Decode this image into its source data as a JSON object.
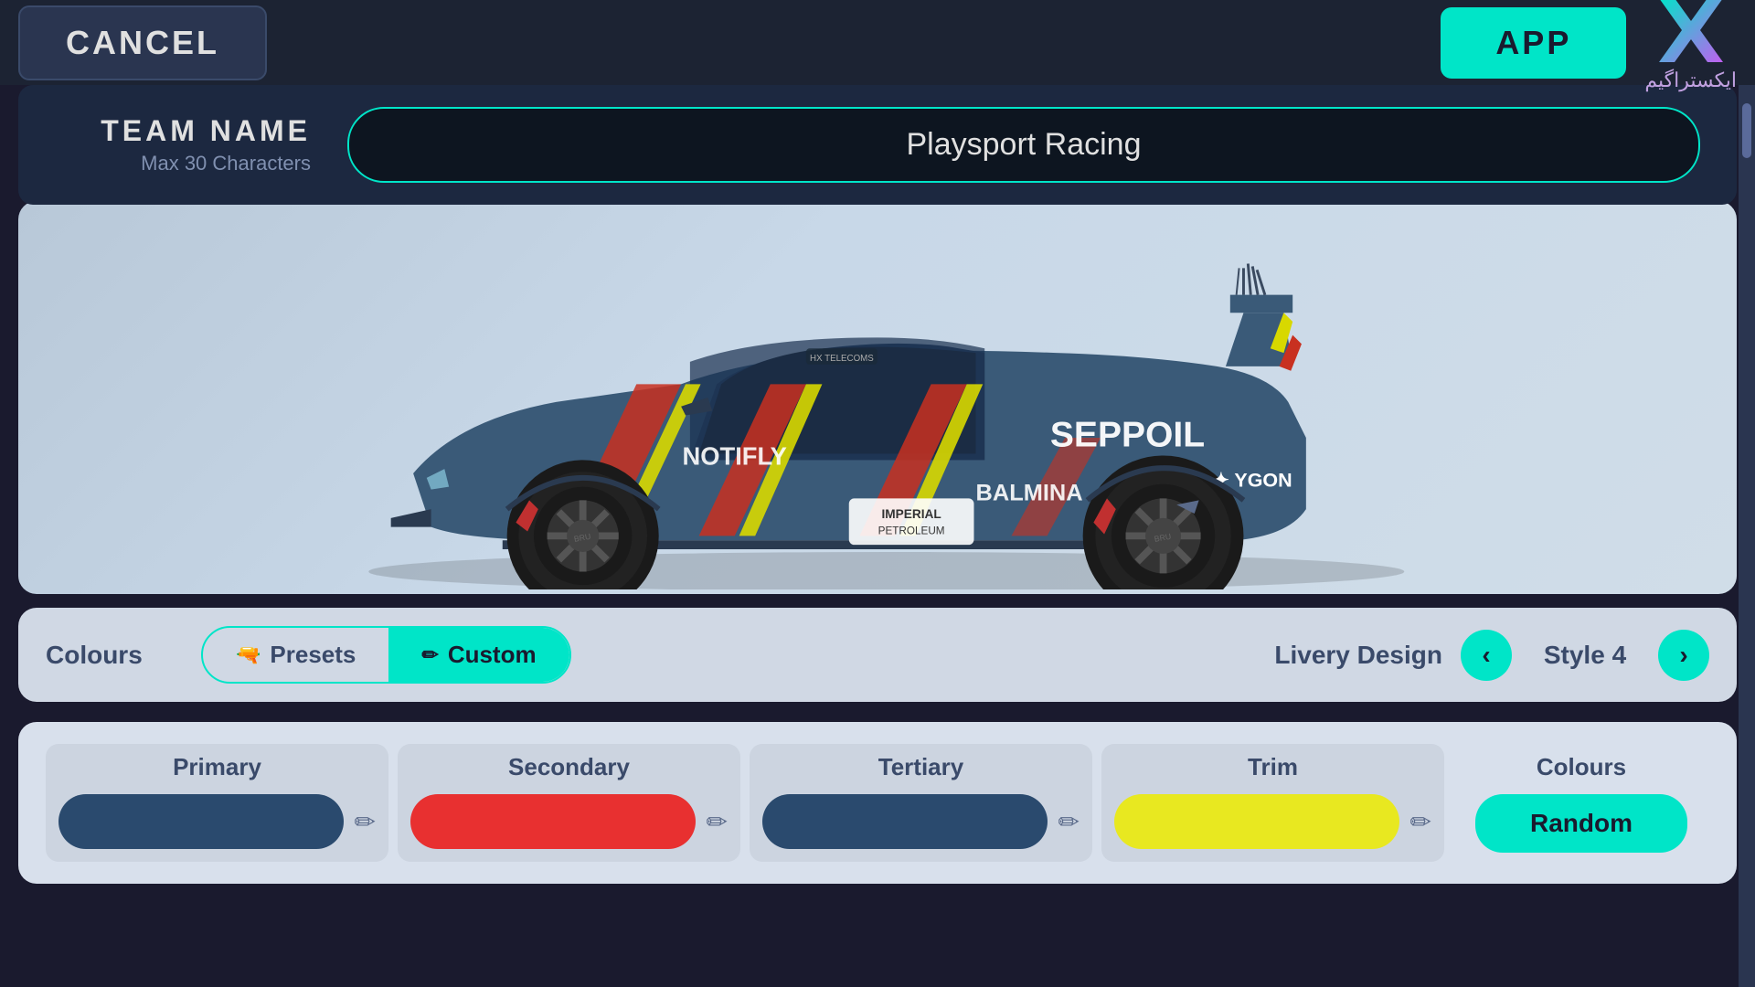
{
  "topBar": {
    "cancelLabel": "CANCEL",
    "applyLabel": "APP",
    "logoAlt": "ExtraGame Logo",
    "logoText": "ايكستراگيم"
  },
  "teamName": {
    "titleLabel": "TEAM NAME",
    "subtitleLabel": "Max 30 Characters",
    "inputValue": "Playsport Racing",
    "inputPlaceholder": "Playsport Racing"
  },
  "car": {
    "sponsors": [
      "HX TELECOMS",
      "SEPPOIL",
      "IMPERIAL PETROLEUM",
      "NOTIFLY",
      "BALMINA",
      "YGON"
    ]
  },
  "controls": {
    "coloursLabel": "Colours",
    "presetsLabel": "Presets",
    "customLabel": "Custom",
    "liveryLabel": "Livery Design",
    "styleLabel": "Style 4",
    "navPrev": "‹",
    "navNext": "›"
  },
  "swatches": {
    "primary": {
      "label": "Primary",
      "color": "#2a4a6e"
    },
    "secondary": {
      "label": "Secondary",
      "color": "#e83030"
    },
    "tertiary": {
      "label": "Tertiary",
      "color": "#2a4a6e"
    },
    "trim": {
      "label": "Trim",
      "color": "#e8e820"
    },
    "coloursSection": {
      "label": "Colours",
      "randomLabel": "Random"
    }
  },
  "icons": {
    "pencil": "✏",
    "preset": "🔫",
    "paint": "✏",
    "chevronLeft": "‹",
    "chevronRight": "›"
  }
}
